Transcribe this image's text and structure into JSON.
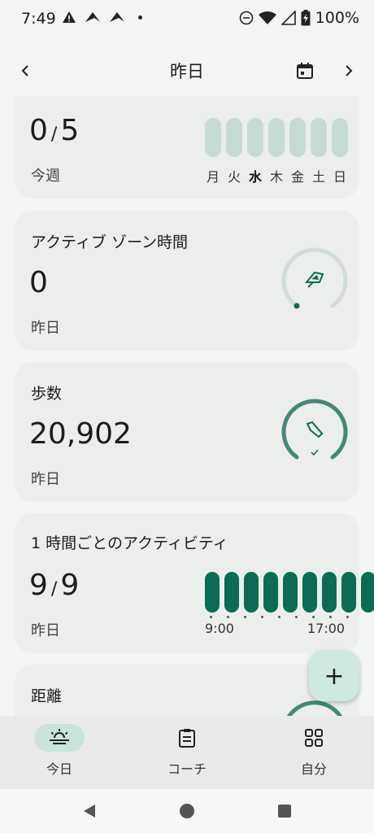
{
  "status_bar": {
    "time": "7:49",
    "battery": "100%"
  },
  "header": {
    "title": "昨日",
    "back_icon": "chevron-left-icon",
    "calendar_icon": "calendar-icon",
    "forward_icon": "chevron-right-icon"
  },
  "cards": {
    "weekly": {
      "value": "0",
      "target": "5",
      "subtitle": "今週",
      "days": [
        "月",
        "火",
        "水",
        "木",
        "金",
        "土",
        "日"
      ],
      "today_index": 2
    },
    "active_zone": {
      "label": "アクティブ ゾーン時間",
      "value": "0",
      "subtitle": "昨日",
      "progress": 0
    },
    "steps": {
      "label": "歩数",
      "value": "20,902",
      "subtitle": "昨日",
      "progress": 1.0
    },
    "hourly": {
      "label": "1 時間ごとのアクティビティ",
      "value": "9",
      "target": "9",
      "subtitle": "昨日",
      "start_label": "9:00",
      "end_label": "17:00"
    },
    "distance": {
      "label": "距離"
    }
  },
  "fab": {
    "label": "+"
  },
  "bottom_nav": {
    "items": [
      {
        "label": "今日",
        "icon": "sunrise-icon",
        "active": true
      },
      {
        "label": "コーチ",
        "icon": "clipboard-icon",
        "active": false
      },
      {
        "label": "自分",
        "icon": "grid-icon",
        "active": false
      }
    ]
  },
  "colors": {
    "accent": "#0b6b55",
    "accent_light": "#c7dbd5",
    "background": "#f3f5f2",
    "card": "#eceeeb"
  }
}
